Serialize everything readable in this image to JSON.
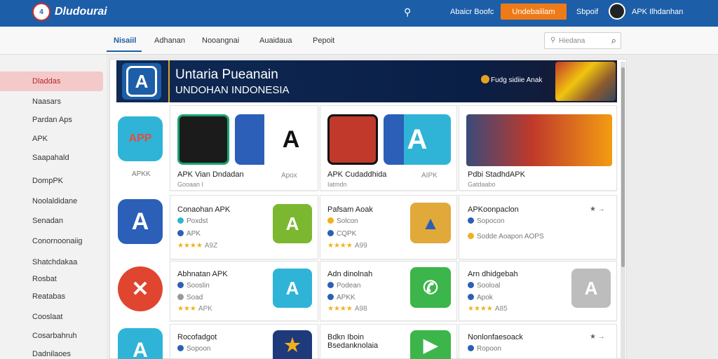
{
  "header": {
    "logo_text": "Dludourai",
    "logo_badge": "4",
    "link1": "Abaicr Boofc",
    "cta_button": "Undebaiilam",
    "link2": "Sbpoif",
    "user": "APK   Ilhdanhan",
    "search_icon": "magnifier-icon"
  },
  "nav": {
    "tabs": [
      "Nisaiil",
      "Adhanan",
      "Nooangnai",
      "Auaidaua",
      "Pepoit"
    ],
    "active_index": 0,
    "search_placeholder": "Hiedana"
  },
  "sidebar": {
    "items": [
      "Dladdas",
      "Naasars",
      "Pardan Aps",
      "APK",
      "Saapahald",
      "DompPK",
      "Noolaldidane",
      "Senadan",
      "Conornoonaiig",
      "Shatchdakaa",
      "Rosbat",
      "Reatabas",
      "Cooslaat",
      "Cosarbahruh",
      "Dadnilaoes"
    ],
    "active_index": 0
  },
  "banner": {
    "title": "Untaria Pueanain",
    "subtitle": "UNDOHAN INDONESIA",
    "tag": "Fudg sidiie Anak",
    "logo_glyph": "A"
  },
  "left_apps": [
    {
      "label": "APP",
      "caption": "APKK",
      "color": "#2fb4d8"
    },
    {
      "label": "A",
      "caption": "",
      "color": "#2b5fb8"
    },
    {
      "label": "✕",
      "caption": "",
      "color": "#e0452f"
    },
    {
      "label": "A",
      "caption": "",
      "color": "#2fb4d8"
    }
  ],
  "featured": [
    {
      "title": "APK Vian Dndadan",
      "sub": "Gooaan I",
      "side_caption": "Apox",
      "side_glyph": "A"
    },
    {
      "title": "APK Cudaddhida",
      "sub": "Iatmdn",
      "side_caption": "AIPK"
    },
    {
      "title": "Pdbi StadhdАPK",
      "sub": "Gatdaabo"
    }
  ],
  "app_rows": [
    [
      {
        "title": "Conaohan APK",
        "m1": "Poxdst",
        "m2": "APK",
        "stars": "★★★★",
        "rating": "A9Z",
        "glyph": "A"
      },
      {
        "title": "Pafsam Aoak",
        "m1": "Solcon",
        "m2": "CQPK",
        "stars": "★★★★",
        "rating": "A99",
        "glyph": "▲"
      },
      {
        "title": "APKoonpaclon",
        "m1": "Sopocon",
        "m2": "Sodde Aoapon  AOPS",
        "stars": "",
        "rating": "",
        "corner": "★ →"
      }
    ],
    [
      {
        "title": "Abhnatan APK",
        "m1": "Sooslin",
        "m2": "Soad",
        "stars": "★★★",
        "rating": "APK",
        "glyph": "A"
      },
      {
        "title": "Adn dinolnah",
        "m1": "Podean",
        "m2": "APKK",
        "stars": "★★★★",
        "rating": "A98",
        "glyph": "✆"
      },
      {
        "title": "Arn dhidgebah",
        "m1": "Sooloal",
        "m2": "Apok",
        "stars": "★★★★",
        "rating": "A85",
        "glyph": "A",
        "corner": "★ →"
      }
    ],
    [
      {
        "title": "Rocofadgot",
        "m1": "Sopoon",
        "m2": "",
        "stars": "",
        "rating": "",
        "glyph": "★"
      },
      {
        "title": "Bdkn Iboin Bsedanknolaia",
        "m1": "",
        "m2": "",
        "stars": "",
        "rating": "",
        "glyph": "▶"
      },
      {
        "title": "Nonlonfaesoack",
        "m1": "Ropoon",
        "m2": "",
        "stars": "",
        "rating": "",
        "corner": "★ →"
      }
    ]
  ]
}
